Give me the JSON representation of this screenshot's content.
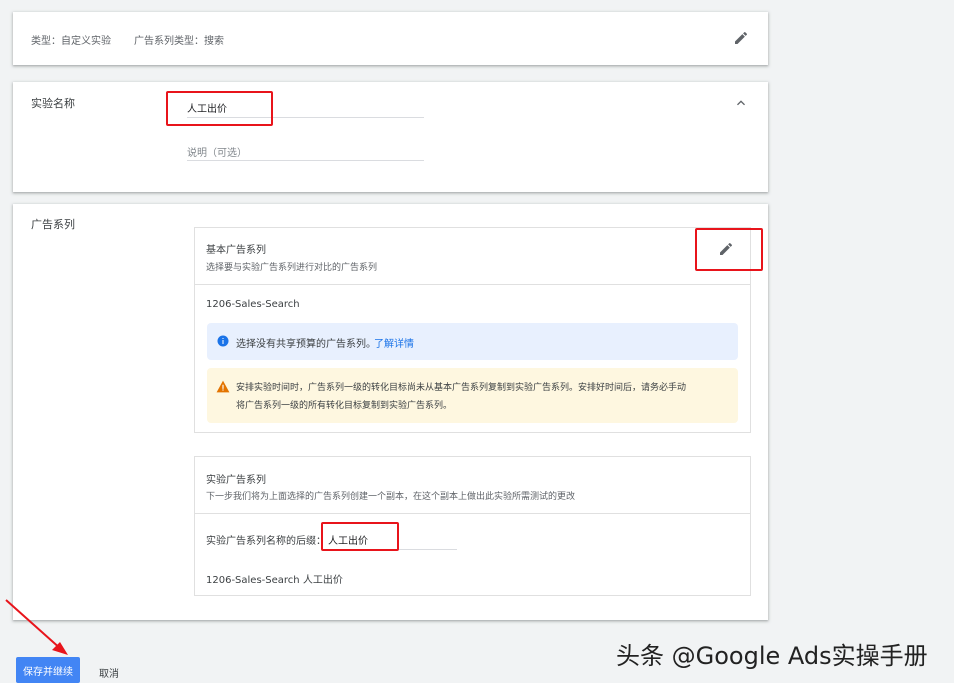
{
  "summary": {
    "type_text": "类型：自定义实验",
    "campaign_type_text": "广告系列类型：搜索"
  },
  "name_section": {
    "title": "实验名称",
    "name_value": "人工出价",
    "description_placeholder": "说明（可选）"
  },
  "campaigns_section": {
    "title": "广告系列",
    "base": {
      "title": "基本广告系列",
      "subtitle": "选择要与实验广告系列进行对比的广告系列",
      "campaign_name": "1206-Sales-Search",
      "info_text": "选择没有共享预算的广告系列。",
      "info_link": "了解详情",
      "warning_line1": "安排实验时间时，广告系列一级的转化目标尚未从基本广告系列复制到实验广告系列。安排好时间后，请务必手动",
      "warning_line2": "将广告系列一级的所有转化目标复制到实验广告系列。"
    },
    "experiment": {
      "title": "实验广告系列",
      "subtitle": "下一步我们将为上面选择的广告系列创建一个副本，在这个副本上做出此实验所需测试的更改",
      "suffix_label": "实验广告系列名称的后缀：",
      "suffix_value": "人工出价",
      "result_name": "1206-Sales-Search 人工出价"
    }
  },
  "footer": {
    "save_label": "保存并继续",
    "cancel_label": "取消"
  },
  "watermark": "头条 @Google Ads实操手册",
  "colors": {
    "accent": "#4285f4",
    "highlight_box": "#e8141b",
    "info_bg": "#e8f0fe",
    "warn_bg": "#fef7e0",
    "info_icon": "#1a73e8",
    "warn_icon": "#e37400"
  }
}
